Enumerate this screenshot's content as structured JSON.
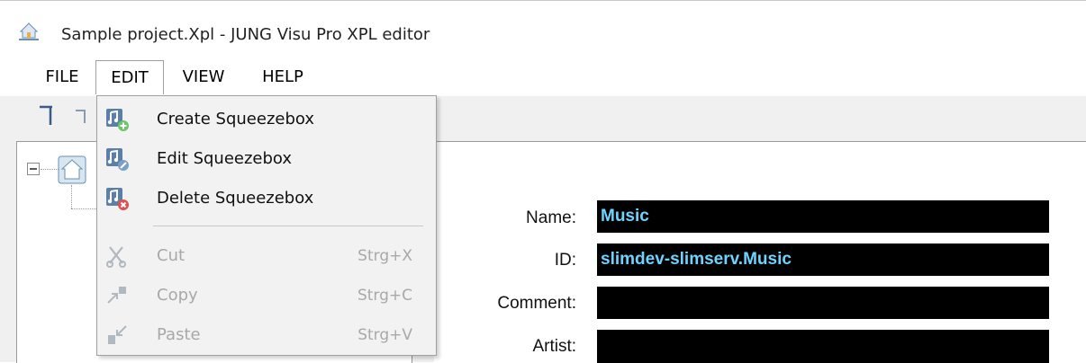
{
  "window": {
    "title": "Sample project.Xpl - JUNG Visu Pro XPL editor",
    "app_icon": "app-house-icon"
  },
  "menubar": {
    "items": [
      {
        "label": "FILE"
      },
      {
        "label": "EDIT"
      },
      {
        "label": "VIEW"
      },
      {
        "label": "HELP"
      }
    ],
    "active": "EDIT"
  },
  "edit_menu": {
    "items": [
      {
        "label": "Create Squeezebox",
        "shortcut": "",
        "icon": "squeezebox-create-icon",
        "enabled": true
      },
      {
        "label": "Edit Squeezebox",
        "shortcut": "",
        "icon": "squeezebox-edit-icon",
        "enabled": true
      },
      {
        "label": "Delete Squeezebox",
        "shortcut": "",
        "icon": "squeezebox-delete-icon",
        "enabled": true
      },
      {
        "label": "Cut",
        "shortcut": "Strg+X",
        "icon": "cut-icon",
        "enabled": false
      },
      {
        "label": "Copy",
        "shortcut": "Strg+C",
        "icon": "copy-icon",
        "enabled": false
      },
      {
        "label": "Paste",
        "shortcut": "Strg+V",
        "icon": "paste-icon",
        "enabled": false
      }
    ]
  },
  "form": {
    "name_label": "Name:",
    "name_value": "Music",
    "id_label": "ID:",
    "id_value": "slimdev-slimserv.Music",
    "comment_label": "Comment:",
    "comment_value": "",
    "artist_label": "Artist:",
    "artist_value": ""
  },
  "colors": {
    "field_background": "#000000",
    "field_text": "#6fd3ff",
    "menu_background": "#f2f2f2"
  }
}
